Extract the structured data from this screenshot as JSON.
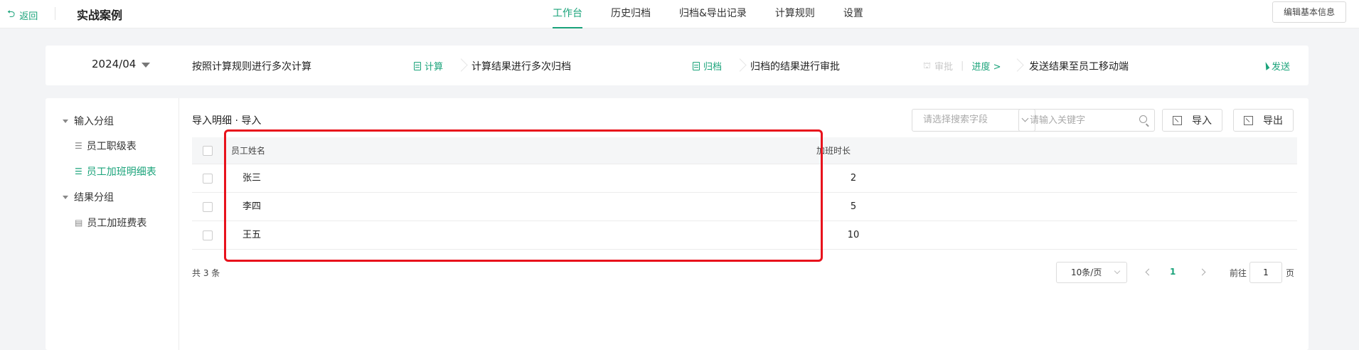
{
  "topbar": {
    "back_label": "返回",
    "title": "实战案例",
    "tabs": [
      {
        "label": "工作台",
        "active": true
      },
      {
        "label": "历史归档",
        "active": false
      },
      {
        "label": "归档&导出记录",
        "active": false
      },
      {
        "label": "计算规则",
        "active": false
      },
      {
        "label": "设置",
        "active": false
      }
    ],
    "edit_button": "编辑基本信息"
  },
  "stepbar": {
    "month": "2024/04",
    "step1_text": "按照计算规则进行多次计算",
    "step1_action": "计算",
    "step2_text": "计算结果进行多次归档",
    "step2_action": "归档",
    "step3_text": "归档的结果进行审批",
    "step3_action": "审批",
    "step3_progress": "进度 >",
    "step4_text": "发送结果至员工移动端",
    "step4_action": "发送"
  },
  "sidebar": {
    "groups": [
      {
        "label": "输入分组",
        "items": [
          {
            "label": "员工职级表",
            "active": false
          },
          {
            "label": "员工加班明细表",
            "active": true
          }
        ]
      },
      {
        "label": "结果分组",
        "items": [
          {
            "label": "员工加班费表",
            "active": false
          }
        ]
      }
    ]
  },
  "content": {
    "title": "导入明细 · 导入",
    "search_field_placeholder": "请选择搜索字段",
    "keyword_placeholder": "请输入关键字",
    "import_button": "导入",
    "export_button": "导出"
  },
  "table": {
    "headers": {
      "name": "员工姓名",
      "hours": "加班时长"
    },
    "rows": [
      {
        "name": "张三",
        "hours": "2"
      },
      {
        "name": "李四",
        "hours": "5"
      },
      {
        "name": "王五",
        "hours": "10"
      }
    ]
  },
  "pagination": {
    "total": "共 3 条",
    "page_size": "10条/页",
    "current_page": "1",
    "goto_label": "前往",
    "goto_value": "1",
    "goto_suffix": "页"
  },
  "colors": {
    "accent": "#1aa37a",
    "highlight": "#e8121c"
  }
}
